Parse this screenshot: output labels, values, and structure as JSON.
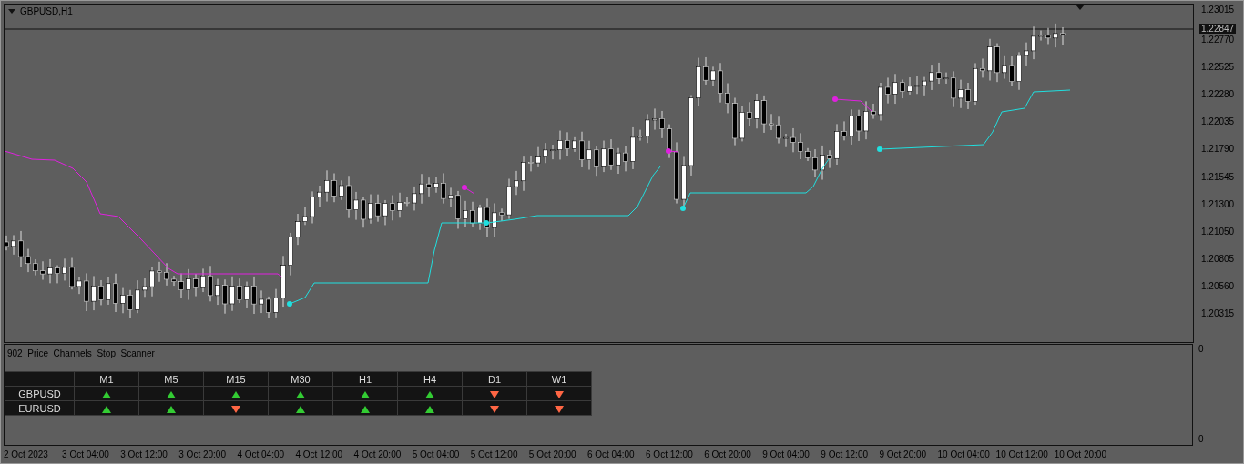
{
  "chart": {
    "title": "GBPUSD,H1",
    "current_price": "1.22847"
  },
  "price_axis": [
    "1.23015",
    "1.22770",
    "1.22525",
    "1.22280",
    "1.22035",
    "1.21790",
    "1.21545",
    "1.21300",
    "1.21050",
    "1.20805",
    "1.20560",
    "1.20315"
  ],
  "indicator": {
    "title": "902_Price_Channels_Stop_Scanner",
    "axis": [
      "0",
      "0"
    ],
    "columns": [
      "M1",
      "M5",
      "M15",
      "M30",
      "H1",
      "H4",
      "D1",
      "W1"
    ],
    "rows": [
      {
        "symbol": "GBPUSD",
        "signals": [
          {
            "up": true
          },
          {
            "up": true
          },
          {
            "up": true
          },
          {
            "up": true
          },
          {
            "up": true
          },
          {
            "up": true
          },
          {
            "up": false
          },
          {
            "up": false
          }
        ]
      },
      {
        "symbol": "EURUSD",
        "signals": [
          {
            "up": true
          },
          {
            "up": true
          },
          {
            "up": false
          },
          {
            "up": true
          },
          {
            "up": true
          },
          {
            "up": true
          },
          {
            "up": false
          },
          {
            "up": false
          }
        ]
      }
    ]
  },
  "time_axis": [
    "2 Oct 2023",
    "3 Oct 04:00",
    "3 Oct 12:00",
    "3 Oct 20:00",
    "4 Oct 04:00",
    "4 Oct 12:00",
    "4 Oct 20:00",
    "5 Oct 04:00",
    "5 Oct 12:00",
    "5 Oct 20:00",
    "6 Oct 04:00",
    "6 Oct 12:00",
    "6 Oct 20:00",
    "9 Oct 04:00",
    "9 Oct 12:00",
    "9 Oct 20:00",
    "10 Oct 04:00",
    "10 Oct 12:00",
    "10 Oct 20:00"
  ]
}
